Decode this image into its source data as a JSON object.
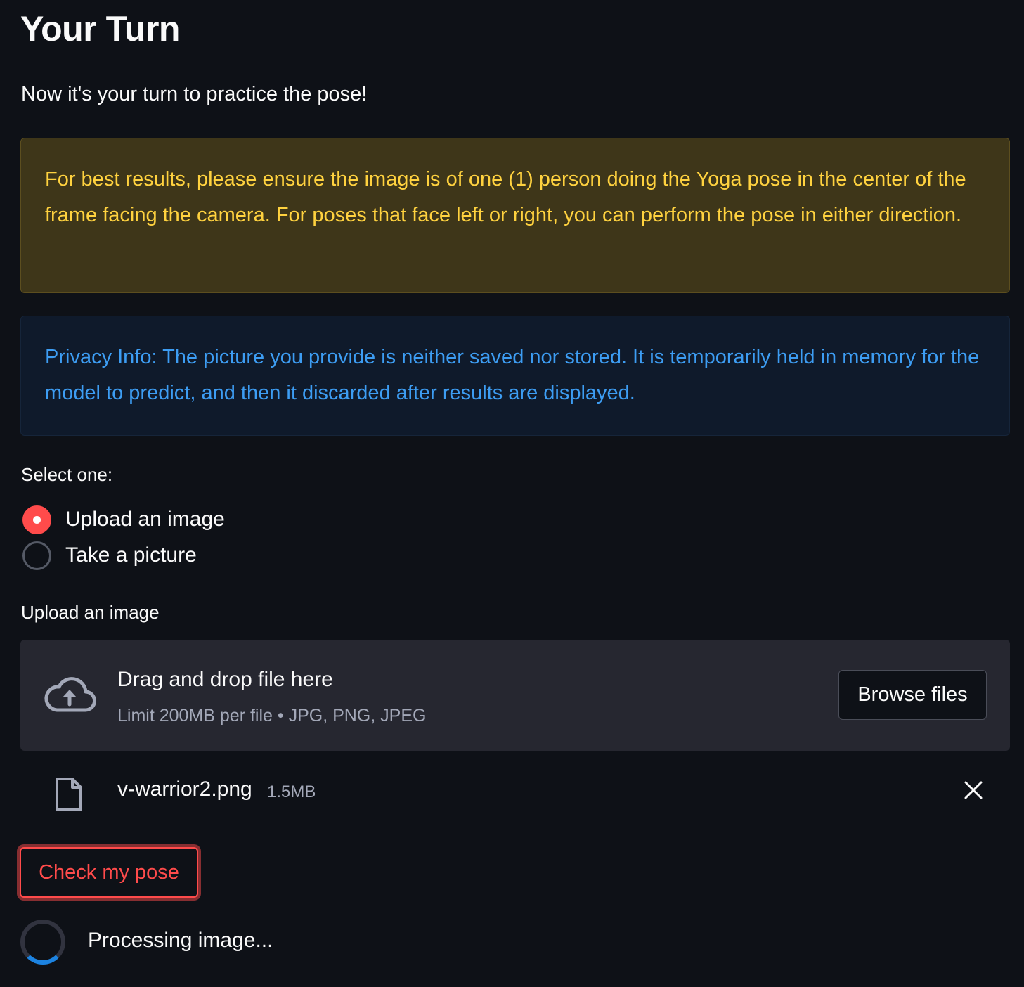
{
  "header": {
    "title": "Your Turn",
    "intro": "Now it's your turn to practice the pose!"
  },
  "alerts": {
    "warning": "For best results, please ensure the image is of one (1) person doing the Yoga pose in the center of the frame facing the camera. For poses that face left or right, you can perform the pose in either direction.",
    "info": "Privacy Info: The picture you provide is neither saved nor stored. It is temporarily held in memory for the model to predict, and then it discarded after results are displayed."
  },
  "source_select": {
    "label": "Select one:",
    "options": [
      {
        "label": "Upload an image",
        "selected": true
      },
      {
        "label": "Take a picture",
        "selected": false
      }
    ]
  },
  "uploader": {
    "label": "Upload an image",
    "drop_text": "Drag and drop file here",
    "limit_text": "Limit 200MB per file • JPG, PNG, JPEG",
    "browse_label": "Browse files",
    "icon": "cloud-upload-icon"
  },
  "uploaded_file": {
    "name": "v-warrior2.png",
    "size": "1.5MB",
    "icon": "file-icon"
  },
  "actions": {
    "check_label": "Check my pose"
  },
  "status": {
    "text": "Processing image..."
  },
  "colors": {
    "background": "#0e1117",
    "accent": "#ff4b4b",
    "warning_text": "#ffd23f",
    "info_text": "#3d9df3",
    "spinner": "#1c83e1"
  }
}
